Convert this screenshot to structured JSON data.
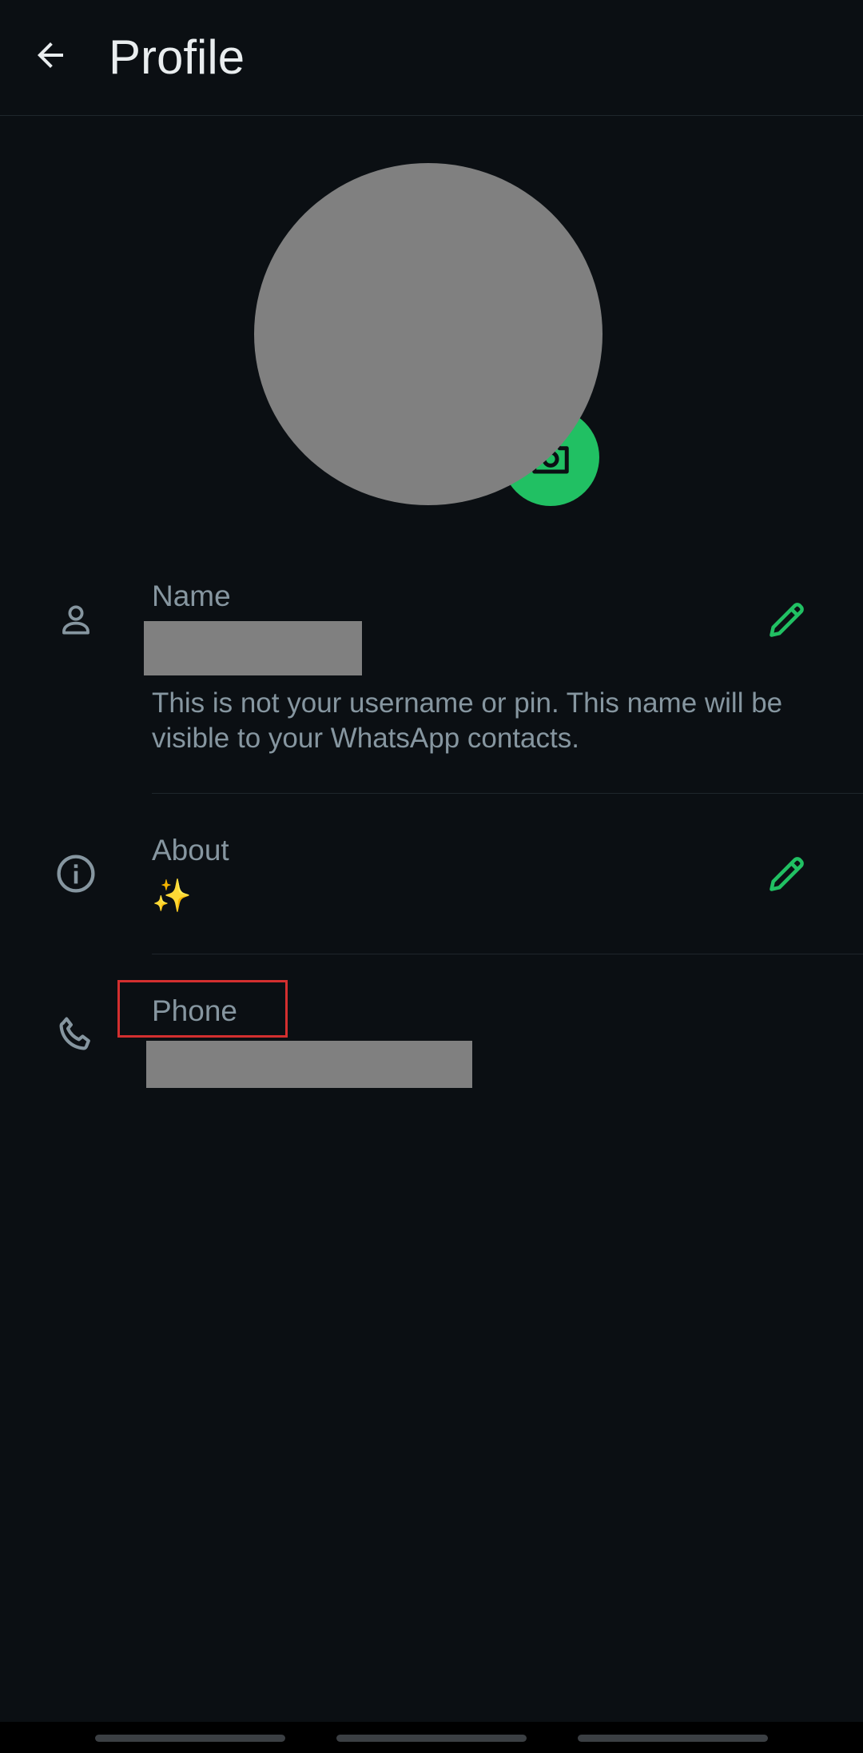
{
  "header": {
    "title": "Profile",
    "back_icon": "arrow-back-icon"
  },
  "avatar": {
    "camera_icon": "camera-icon",
    "accent_color": "#21c063"
  },
  "name_row": {
    "icon": "person-icon",
    "label": "Name",
    "helper_text": "This is not your username or pin. This name will be visible to your WhatsApp contacts.",
    "edit_icon": "pencil-icon"
  },
  "about_row": {
    "icon": "info-icon",
    "label": "About",
    "value": "✨",
    "edit_icon": "pencil-icon"
  },
  "phone_row": {
    "icon": "phone-icon",
    "label": "Phone"
  },
  "colors": {
    "background": "#0b0f13",
    "accent": "#21c063",
    "label": "#8696a0",
    "title": "#e9edef",
    "highlight": "#d32f2f"
  }
}
